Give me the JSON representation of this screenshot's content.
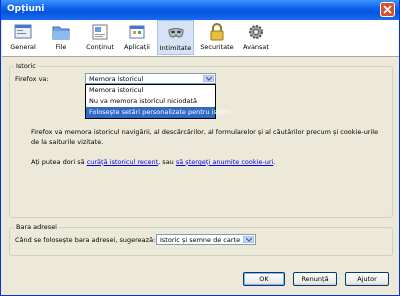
{
  "window": {
    "title": "Opțiuni"
  },
  "toolbar": {
    "tabs": [
      {
        "label": "General",
        "icon": "general-icon"
      },
      {
        "label": "File",
        "icon": "file-icon"
      },
      {
        "label": "Conținut",
        "icon": "content-icon"
      },
      {
        "label": "Aplicații",
        "icon": "applications-icon"
      },
      {
        "label": "Intimitate",
        "icon": "privacy-mask-icon",
        "active": true
      },
      {
        "label": "Securitate",
        "icon": "lock-icon"
      },
      {
        "label": "Avansat",
        "icon": "gear-icon"
      }
    ]
  },
  "istoric": {
    "legend": "Istoric",
    "firefox_label": "Firefox va:",
    "selected": "Memora istoricul",
    "options": [
      "Memora istoricul",
      "Nu va memora istoricul niciodată",
      "Folosește setări personalizate pentru istoric"
    ],
    "highlighted_index": 2,
    "description": "Firefox va memora istoricul navigării, al descărcărilor, al formularelor și al căutărilor precum și cookie-urile de la saiturile vizitate.",
    "clear_prefix": "Ați putea dori să ",
    "clear_link": "curăță istoricul recent",
    "clear_middle": ", sau ",
    "cookies_link": "să ștergeți anumite cookie-uri",
    "clear_suffix": "."
  },
  "bara": {
    "legend": "Bara adresei",
    "label": "Când se folosește bara adresei, sugerează:",
    "selected": "Istoric și semne de carte"
  },
  "buttons": {
    "ok": "OK",
    "cancel": "Renunță",
    "help": "Ajutor"
  },
  "colors": {
    "titlebar": "#0a5ee8",
    "selection": "#316ac5",
    "link": "#0000ee"
  }
}
